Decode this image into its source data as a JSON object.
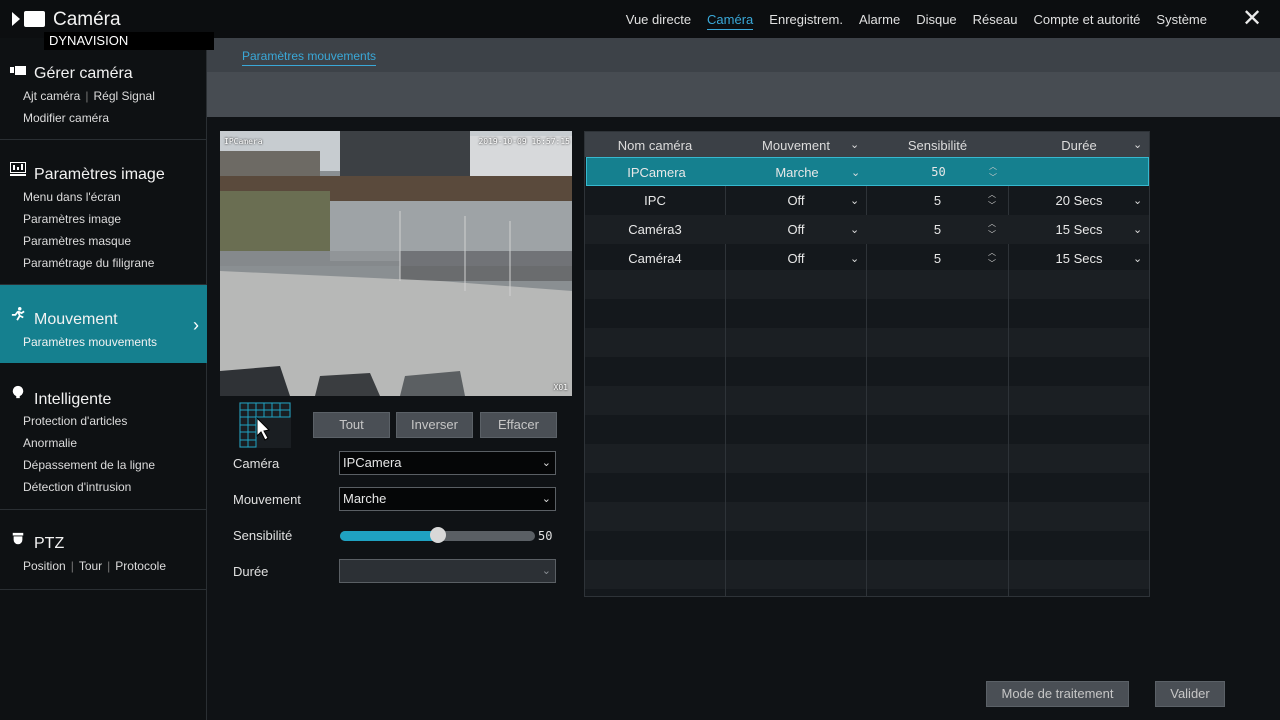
{
  "app": {
    "title": "Caméra",
    "brand": "DYNAVISION"
  },
  "nav": {
    "items": [
      "Vue directe",
      "Caméra",
      "Enregistrem.",
      "Alarme",
      "Disque",
      "Réseau",
      "Compte et autorité",
      "Système"
    ],
    "active": "Caméra"
  },
  "sidebar": {
    "gerer": {
      "title": "Gérer caméra",
      "items": [
        "Ajt caméra",
        "Régl Signal",
        "Modifier caméra"
      ]
    },
    "image": {
      "title": "Paramètres image",
      "items": [
        "Menu dans l'écran",
        "Paramètres image",
        "Paramètres masque",
        "Paramétrage du filigrane"
      ]
    },
    "mouvement": {
      "title": "Mouvement",
      "items": [
        "Paramètres mouvements"
      ]
    },
    "intelligente": {
      "title": "Intelligente",
      "items": [
        "Protection d'articles",
        "Anormalie",
        "Dépassement de la ligne",
        "Détection d'intrusion"
      ]
    },
    "ptz": {
      "title": "PTZ",
      "items": [
        "Position",
        "Tour",
        "Protocole"
      ]
    }
  },
  "tab": {
    "label": "Paramètres mouvements"
  },
  "preview": {
    "camera_label": "IPCamera",
    "timestamp": "2019-10-09 16:57:15",
    "channel": "X01"
  },
  "grid_buttons": {
    "all": "Tout",
    "invert": "Inverser",
    "clear": "Effacer"
  },
  "form": {
    "camera_label": "Caméra",
    "camera_value": "IPCamera",
    "motion_label": "Mouvement",
    "motion_value": "Marche",
    "sensitivity_label": "Sensibilité",
    "sensitivity_value": "50",
    "sensitivity_level": 50,
    "duration_label": "Durée",
    "duration_value": ""
  },
  "table": {
    "headers": [
      "Nom caméra",
      "Mouvement",
      "Sensibilité",
      "Durée"
    ],
    "rows": [
      {
        "name": "IPCamera",
        "motion": "Marche",
        "sensitivity": "50",
        "duration": "",
        "selected": true
      },
      {
        "name": "IPC",
        "motion": "Off",
        "sensitivity": "5",
        "duration": "20 Secs",
        "selected": false
      },
      {
        "name": "Caméra3",
        "motion": "Off",
        "sensitivity": "5",
        "duration": "15 Secs",
        "selected": false
      },
      {
        "name": "Caméra4",
        "motion": "Off",
        "sensitivity": "5",
        "duration": "15 Secs",
        "selected": false
      }
    ]
  },
  "footer": {
    "processing_mode": "Mode de traitement",
    "validate": "Valider"
  },
  "colors": {
    "accent": "#15808f",
    "link": "#3aa8d8"
  }
}
